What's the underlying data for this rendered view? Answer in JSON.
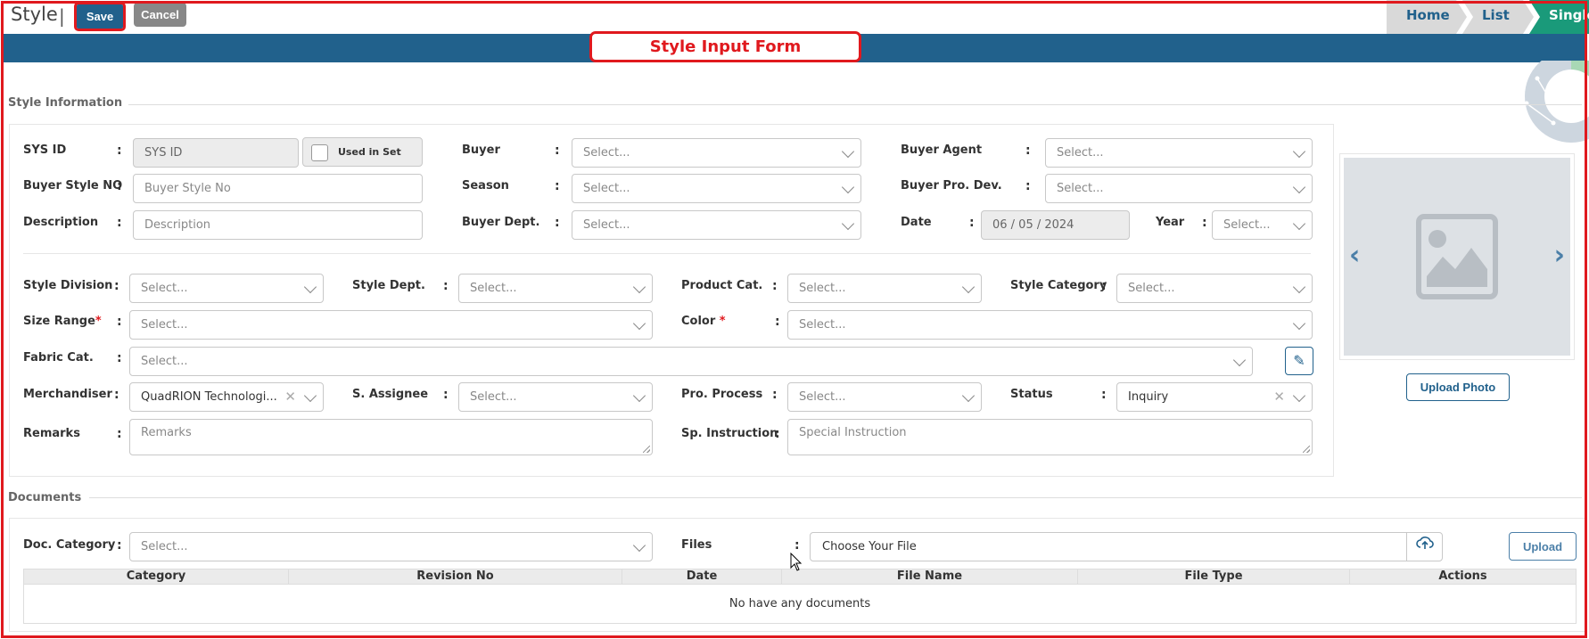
{
  "header": {
    "page_title": "Style",
    "title_separator": "|",
    "save_label": "Save",
    "cancel_label": "Cancel",
    "breadcrumbs": [
      "Home",
      "List",
      "Single S"
    ]
  },
  "banner": {
    "form_title": "Style Input Form"
  },
  "style_info": {
    "section_title": "Style Information",
    "sys_id": {
      "label": "SYS ID",
      "placeholder": "SYS ID"
    },
    "used_in_set_pack": "Used in Set Pack",
    "buyer": {
      "label": "Buyer",
      "value": "Select..."
    },
    "buyer_agent": {
      "label": "Buyer Agent",
      "value": "Select..."
    },
    "buyer_style_no": {
      "label": "Buyer Style NO",
      "placeholder": "Buyer Style No"
    },
    "season": {
      "label": "Season",
      "value": "Select..."
    },
    "buyer_pro_dev": {
      "label": "Buyer Pro. Dev.",
      "value": "Select..."
    },
    "description": {
      "label": "Description",
      "placeholder": "Description"
    },
    "buyer_dept": {
      "label": "Buyer Dept.",
      "value": "Select..."
    },
    "date": {
      "label": "Date",
      "value": "06 / 05 / 2024"
    },
    "year": {
      "label": "Year",
      "value": "Select..."
    },
    "style_division": {
      "label": "Style Division",
      "value": "Select..."
    },
    "style_dept": {
      "label": "Style Dept.",
      "value": "Select..."
    },
    "product_cat": {
      "label": "Product Cat.",
      "value": "Select..."
    },
    "style_category": {
      "label": "Style Category",
      "value": "Select..."
    },
    "size_range": {
      "label": "Size Range",
      "required": "*",
      "value": "Select..."
    },
    "color": {
      "label": "Color ",
      "required": "*",
      "value": "Select..."
    },
    "fabric_cat": {
      "label": "Fabric Cat.",
      "value": "Select..."
    },
    "merchandiser": {
      "label": "Merchandiser",
      "value": "QuadRION Technologi..."
    },
    "s_assignee": {
      "label": "S. Assignee",
      "value": "Select..."
    },
    "pro_process": {
      "label": "Pro. Process",
      "value": "Select..."
    },
    "status": {
      "label": "Status",
      "value": "Inquiry"
    },
    "remarks": {
      "label": "Remarks",
      "placeholder": "Remarks"
    },
    "sp_instruction": {
      "label": "Sp. Instruction",
      "placeholder": "Special Instruction"
    },
    "colon": ":"
  },
  "photo": {
    "upload_label": "Upload Photo",
    "prev_icon": "‹",
    "next_icon": "›"
  },
  "documents": {
    "section_title": "Documents",
    "doc_category": {
      "label": "Doc. Category",
      "value": "Select..."
    },
    "files": {
      "label": "Files",
      "value": "Choose Your File"
    },
    "upload_label": "Upload",
    "columns": [
      "Category",
      "Revision No",
      "Date",
      "File Name",
      "File Type",
      "Actions"
    ],
    "empty_message": "No have any documents"
  },
  "colors": {
    "primary": "#21618c",
    "accent_red": "#e0191e",
    "breadcrumb_active": "#1a9a7a"
  }
}
